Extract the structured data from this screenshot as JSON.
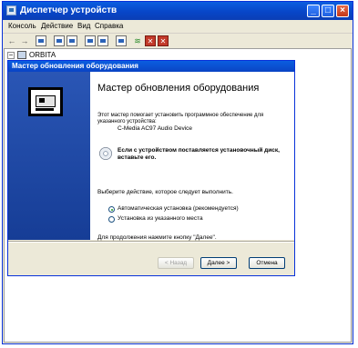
{
  "window": {
    "title": "Диспетчер устройств",
    "controls": {
      "minimize": "_",
      "maximize": "□",
      "close": "×"
    }
  },
  "menu": [
    "Консоль",
    "Действие",
    "Вид",
    "Справка"
  ],
  "toolbar": {
    "icons": [
      "back-arrow-icon",
      "forward-arrow-icon",
      "console-tree-icon",
      "properties-icon",
      "print-icon",
      "help-icon",
      "computer-icon",
      "scan-hardware-icon",
      "disable-device-icon",
      "uninstall-device-icon"
    ],
    "glyphs": {
      "back": "←",
      "forward": "→"
    }
  },
  "tree": {
    "expander": "−",
    "root_label": "ORBITA"
  },
  "wizard": {
    "title": "Мастер обновления оборудования",
    "heading": "Мастер обновления оборудования",
    "description": "Этот мастер помогает установить программное обеспечение для указанного устройства:",
    "device": "C-Media AC97 Audio Device",
    "cd_text": "Если с устройством поставляется установочный диск, вставьте его.",
    "prompt": "Выберите действие, которое следует выполнить.",
    "options": [
      {
        "label": "Автоматическая установка (рекомендуется)",
        "checked": true
      },
      {
        "label": "Установка из указанного места",
        "checked": false
      }
    ],
    "continue_text": "Для продолжения нажмите кнопку \"Далее\".",
    "buttons": {
      "back": "< Назад",
      "next": "Далее >",
      "cancel": "Отмена"
    }
  },
  "colors": {
    "title_bar": "#0a5ee0",
    "banner": "#2a56b5",
    "face": "#ece9d8"
  }
}
